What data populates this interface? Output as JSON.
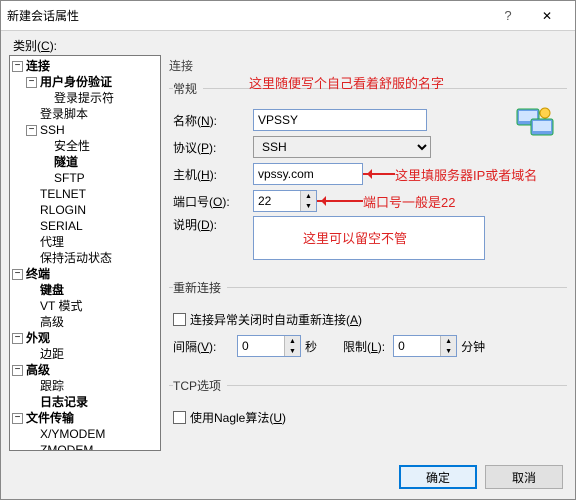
{
  "window": {
    "title": "新建会话属性",
    "help_icon": "?",
    "close_icon": "✕"
  },
  "category_label": "类别",
  "category_hotkey": "C",
  "tree": {
    "items": [
      "连接",
      "用户身份验证",
      "登录提示符",
      "登录脚本",
      "SSH",
      "安全性",
      "隧道",
      "SFTP",
      "TELNET",
      "RLOGIN",
      "SERIAL",
      "代理",
      "保持活动状态",
      "终端",
      "键盘",
      "VT 模式",
      "高级",
      "外观",
      "边距",
      "高级",
      "跟踪",
      "日志记录",
      "文件传输",
      "X/YMODEM",
      "ZMODEM"
    ]
  },
  "conn": {
    "heading": "连接",
    "groups": {
      "general": "常规",
      "reconn": "重新连接",
      "tcp": "TCP选项"
    },
    "labels": {
      "name": "名称",
      "name_k": "N",
      "proto": "协议",
      "proto_k": "P",
      "host": "主机",
      "host_k": "H",
      "port": "端口号",
      "port_k": "O",
      "desc": "说明",
      "desc_k": "D",
      "auto_reconn": "连接异常关闭时自动重新连接",
      "auto_reconn_k": "A",
      "interval": "间隔",
      "interval_k": "V",
      "limit": "限制",
      "limit_k": "L",
      "sec": "秒",
      "min": "分钟",
      "nagle": "使用Nagle算法",
      "nagle_k": "U"
    },
    "values": {
      "name": "VPSSY",
      "proto": "SSH",
      "host": "vpssy.com",
      "port": "22",
      "interval": "0",
      "limit": "0"
    }
  },
  "annotations": {
    "name_tip": "这里随便写个自己看着舒服的名字",
    "host_tip": "这里填服务器IP或者域名",
    "port_tip": "端口号一般是22",
    "desc_tip": "这里可以留空不管"
  },
  "buttons": {
    "ok": "确定",
    "cancel": "取消"
  }
}
